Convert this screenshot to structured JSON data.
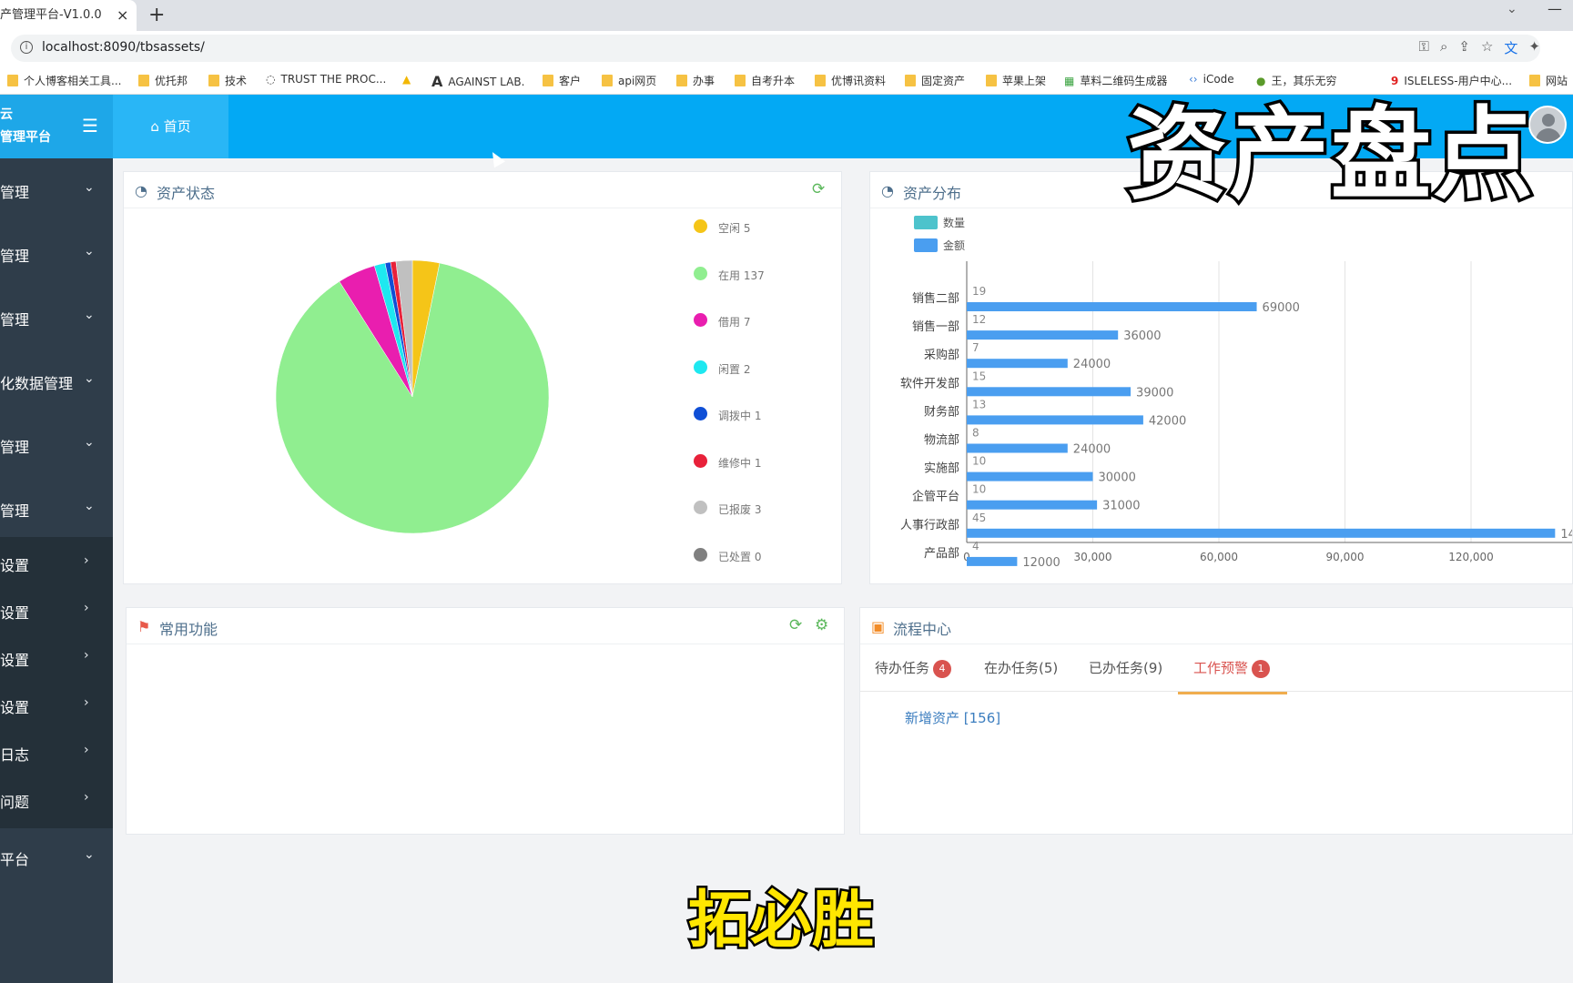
{
  "browser": {
    "tab_title": "产管理平台-V1.0.0",
    "tab_close": "×",
    "new_tab": "+",
    "url": "localhost:8090/tbsassets/",
    "bookmarks": [
      "个人博客相关工具...",
      "优托邦",
      "技术",
      "TRUST THE PROC...",
      "AGAINST LAB.",
      "客户",
      "api网页",
      "办事",
      "自考升本",
      "优博讯资料",
      "固定资产",
      "苹果上架",
      "草料二维码生成器",
      "iCode",
      "王，其乐无穷",
      "ISLELESS-用户中心...",
      "网站"
    ]
  },
  "app": {
    "brand_line1": "云",
    "brand_line2": "管理平台",
    "home_tab": "首页"
  },
  "sidebar": {
    "items": [
      "管理",
      "管理",
      "管理",
      "化数据管理",
      "管理",
      "管理",
      "设置",
      "设置",
      "设置",
      "设置",
      "日志",
      "问题",
      "平台"
    ]
  },
  "asset_status": {
    "title": "资产状态",
    "legend": [
      {
        "label": "空闲",
        "count": "5",
        "color": "#f5c518"
      },
      {
        "label": "在用",
        "count": "137",
        "color": "#90ee90"
      },
      {
        "label": "借用",
        "count": "7",
        "color": "#e91eaf"
      },
      {
        "label": "闲置",
        "count": "2",
        "color": "#1ee8f0"
      },
      {
        "label": "调拨中",
        "count": "1",
        "color": "#0f4fd6"
      },
      {
        "label": "维修中",
        "count": "1",
        "color": "#e8213a"
      },
      {
        "label": "已报废",
        "count": "3",
        "color": "#c0c0c0"
      },
      {
        "label": "已处置",
        "count": "0",
        "color": "#808080"
      }
    ]
  },
  "asset_distribution": {
    "title": "资产分布",
    "legend": [
      "数量",
      "金额"
    ]
  },
  "common_functions": {
    "title": "常用功能"
  },
  "process_center": {
    "title": "流程中心",
    "tabs": [
      {
        "label": "待办任务",
        "badge": "4"
      },
      {
        "label": "在办任务(5)",
        "badge": ""
      },
      {
        "label": "已办任务(9)",
        "badge": ""
      },
      {
        "label": "工作预警",
        "badge": "1"
      }
    ],
    "item": "新增资产 [156]"
  },
  "overlay": {
    "title": "资产盘点",
    "subtitle": "拓必胜"
  },
  "chart_data": [
    {
      "type": "pie",
      "title": "资产状态",
      "categories": [
        "空闲",
        "在用",
        "借用",
        "闲置",
        "调拨中",
        "维修中",
        "已报废",
        "已处置"
      ],
      "values": [
        5,
        137,
        7,
        2,
        1,
        1,
        3,
        0
      ],
      "colors": [
        "#f5c518",
        "#90ee90",
        "#e91eaf",
        "#1ee8f0",
        "#0f4fd6",
        "#e8213a",
        "#c0c0c0",
        "#808080"
      ],
      "legend": "right"
    },
    {
      "type": "bar",
      "orientation": "horizontal",
      "title": "资产分布",
      "categories": [
        "销售二部",
        "销售一部",
        "采购部",
        "软件开发部",
        "财务部",
        "物流部",
        "实施部",
        "企管平台",
        "人事行政部",
        "产品部"
      ],
      "series": [
        {
          "name": "数量",
          "values": [
            19,
            12,
            7,
            15,
            13,
            8,
            10,
            10,
            45,
            4
          ],
          "color": "#4dc3cc"
        },
        {
          "name": "金额",
          "values": [
            69000,
            36000,
            24000,
            39000,
            42000,
            24000,
            30000,
            31000,
            140000,
            12000
          ],
          "color": "#4a9ef0"
        }
      ],
      "x_ticks": [
        "0",
        "30,000",
        "60,000",
        "90,000",
        "120,000"
      ],
      "xlim": [
        0,
        150000
      ],
      "truncated_labels": {
        "8": "14"
      },
      "grid": true,
      "legend": "top-left"
    }
  ]
}
